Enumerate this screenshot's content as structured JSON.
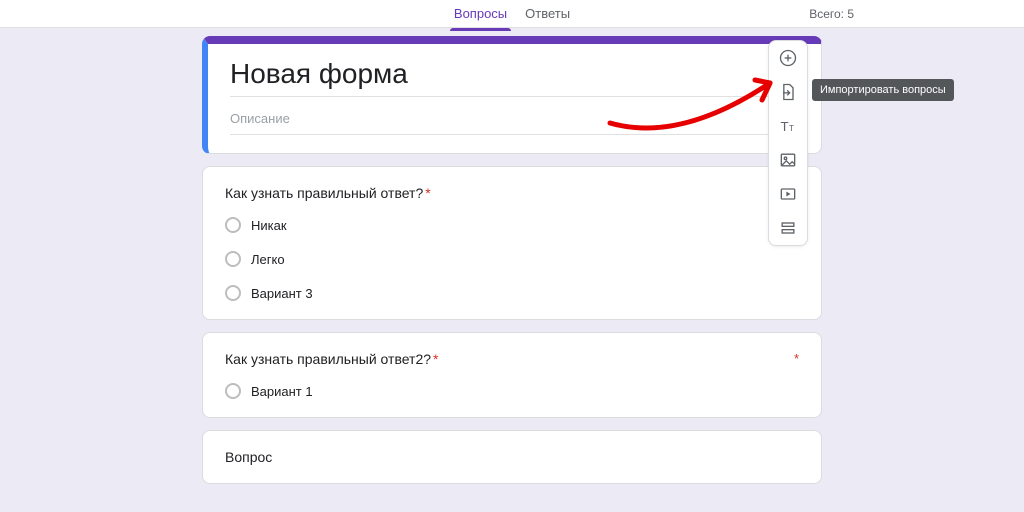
{
  "topbar": {
    "tab_questions": "Вопросы",
    "tab_answers": "Ответы",
    "total_label": "Всего: 5"
  },
  "form": {
    "title": "Новая форма",
    "description": "Описание"
  },
  "questions": [
    {
      "title": "Как узнать правильный ответ?",
      "required": true,
      "options": [
        "Никак",
        "Легко",
        "Вариант 3"
      ]
    },
    {
      "title": "Как узнать правильный ответ2?",
      "required": true,
      "options": [
        "Вариант 1"
      ]
    },
    {
      "title": "Вопрос",
      "required": false,
      "options": []
    }
  ],
  "toolbar": {
    "add_question": "Добавить вопрос",
    "import_questions": "Импортировать вопросы",
    "add_title": "Добавить название и описание",
    "add_image": "Добавить изображение",
    "add_video": "Добавить видео",
    "add_section": "Добавить раздел"
  },
  "tooltip": "Импортировать вопросы"
}
